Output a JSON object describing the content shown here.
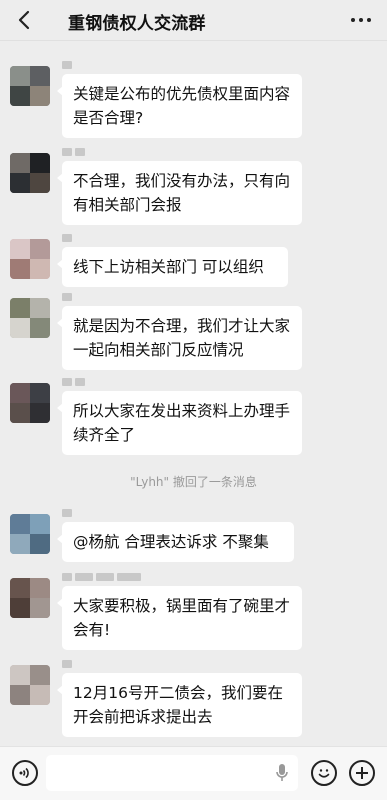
{
  "header": {
    "title": "重钢债权人交流群"
  },
  "messages": [
    {
      "text": "关键是公布的优先债权里面内容是否合理?"
    },
    {
      "text": "不合理，我们没有办法，只有向有相关部门会报"
    },
    {
      "text": "线下上访相关部门  可以组织"
    },
    {
      "text": "就是因为不合理，我们才让大家一起向相关部门反应情况"
    },
    {
      "text": "所以大家在发出来资料上办理手续齐全了"
    },
    {
      "text": "@杨航  合理表达诉求 不聚集"
    },
    {
      "text": "大家要积极，锅里面有了碗里才会有!"
    },
    {
      "text": "12月16号开二债会，我们要在开会前把诉求提出去"
    }
  ],
  "system": {
    "recall": "\"Lyhh\" 撤回了一条消息"
  },
  "icons": {
    "back": "chevron-left-icon",
    "more": "more-dots-icon",
    "voice": "voice-icon",
    "mic": "microphone-icon",
    "emoji": "emoji-icon",
    "plus": "plus-icon"
  },
  "colors": {
    "background": "#ededed",
    "bubble": "#ffffff",
    "text": "#111111",
    "system_text": "#9a9a9a"
  }
}
